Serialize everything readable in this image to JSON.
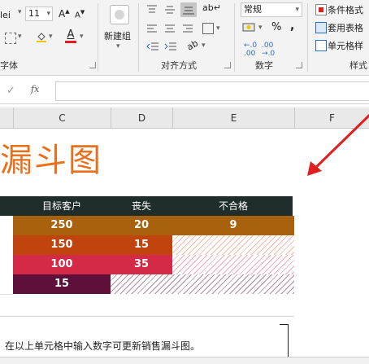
{
  "ribbon": {
    "font_name_partial": "lei",
    "font_size": "11",
    "grow_font": "A",
    "shrink_font": "A",
    "font_group_label_partial": "字体",
    "new_group_label": "新建组",
    "alignment_group_label": "对齐方式",
    "number_format_value": "常规",
    "number_group_label": "数字",
    "percent_symbol": "%",
    "comma_symbol": ",",
    "styles_group_label_partial": "样式",
    "styles_items": [
      "条件格式",
      "套用表格",
      "单元格样"
    ]
  },
  "formula_bar": {
    "fx_label": "fx",
    "content": ""
  },
  "columns": [
    "C",
    "D",
    "E",
    "F"
  ],
  "sheet": {
    "title_partial": "漏斗图",
    "headers": [
      "目标客户",
      "丧失",
      "不合格"
    ],
    "rows": [
      {
        "values": [
          "250",
          "20",
          "9"
        ],
        "color": "#a8610c"
      },
      {
        "values": [
          "150",
          "15",
          ""
        ],
        "color": "#c1440e"
      },
      {
        "values": [
          "100",
          "35",
          ""
        ],
        "color": "#d42a48"
      },
      {
        "values": [
          "15",
          "",
          ""
        ],
        "color": "#5e0f3a"
      }
    ],
    "note": "在以上单元格中输入数字可更新销售漏斗图。"
  },
  "colors": {
    "title": "#e8711f",
    "header_bg": "#1f2d2d",
    "arrow": "#e02020"
  }
}
